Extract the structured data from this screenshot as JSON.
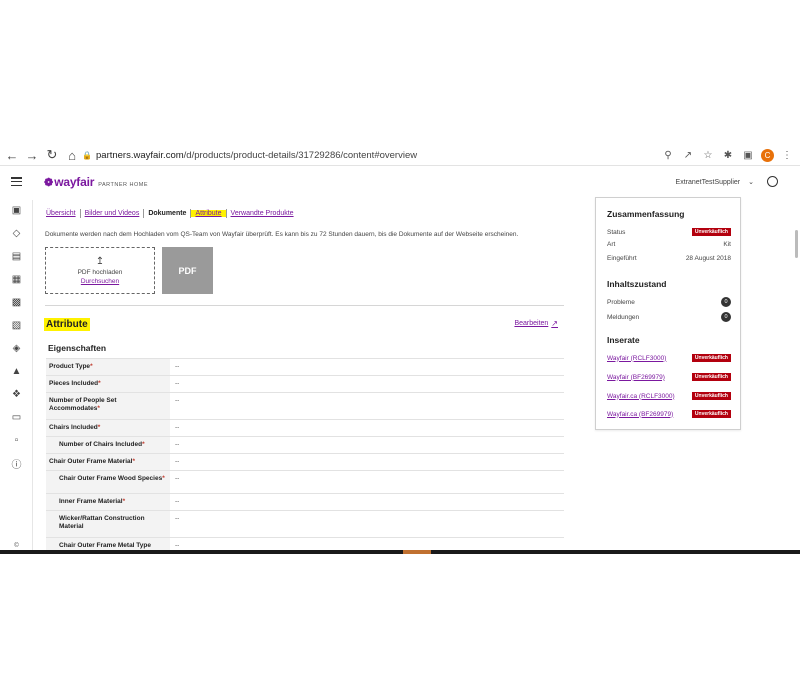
{
  "browser": {
    "url_host": "partners.wayfair.com",
    "url_path": "/d/products/product-details/31729286/content#overview",
    "profile_initial": "C"
  },
  "header": {
    "logo_word": "wayfair",
    "logo_sub": "PARTNER HOME",
    "supplier": "ExtranetTestSupplier"
  },
  "tabs": [
    {
      "label": "Übersicht"
    },
    {
      "label": "Bilder und Videos"
    },
    {
      "label": "Dokumente"
    },
    {
      "label": "Attribute"
    },
    {
      "label": "Verwandte Produkte"
    }
  ],
  "documents": {
    "info": "Dokumente werden nach dem Hochladen vom QS-Team von Wayfair überprüft. Es kann bis zu 72 Stunden dauern, bis die Dokumente auf der Webseite erscheinen.",
    "upload_label": "PDF hochladen",
    "browse_link": "Durchsuchen",
    "pdf_thumb": "PDF"
  },
  "attributes": {
    "heading": "Attribute",
    "edit_link": "Bearbeiten",
    "props_heading": "Eigenschaften",
    "rows": [
      {
        "name": "Product Type",
        "value": "--"
      },
      {
        "name": "Pieces Included",
        "value": "--"
      },
      {
        "name": "Number of People Set Accommodates",
        "value": "--"
      },
      {
        "name": "Chairs Included",
        "value": "--"
      },
      {
        "name": "Number of Chairs Included",
        "value": "--"
      },
      {
        "name": "Chair Outer Frame Material",
        "value": "--"
      },
      {
        "name": "Chair Outer Frame Wood Species",
        "value": "--"
      },
      {
        "name": "Inner Frame Material",
        "value": "--"
      },
      {
        "name": "Wicker/Rattan Construction Material",
        "value": "--"
      },
      {
        "name": "Chair Outer Frame Metal Type",
        "value": "--"
      }
    ]
  },
  "summary": {
    "title": "Zusammenfassung",
    "status_label": "Status",
    "status_value": "Unverkäuflich",
    "type_label": "Art",
    "type_value": "Kit",
    "introduced_label": "Eingeführt",
    "introduced_value": "28 August 2018",
    "content_title": "Inhaltszustand",
    "problems_label": "Probleme",
    "problems_count": "0",
    "reports_label": "Meldungen",
    "reports_count": "0",
    "listings_title": "Inserate",
    "listings": [
      {
        "name": "Wayfair (RCLF3000)",
        "status": "Unverkäuflich"
      },
      {
        "name": "Wayfair (BF269979)",
        "status": "Unverkäuflich"
      },
      {
        "name": "Wayfair.ca (RCLF3000)",
        "status": "Unverkäuflich"
      },
      {
        "name": "Wayfair.ca (BF269979)",
        "status": "Unverkäuflich"
      }
    ]
  },
  "colors": {
    "brand": "#7b189f",
    "highlight": "#fff200",
    "status_red": "#b3000e"
  },
  "icons": {
    "sidebar": [
      "bar-chart-icon",
      "tag-icon",
      "bag-icon",
      "store-icon",
      "image-icon",
      "calendar-icon",
      "price-tag-icon",
      "boxes-icon",
      "support-icon",
      "clipboard-icon",
      "document-icon",
      "help-icon"
    ]
  }
}
